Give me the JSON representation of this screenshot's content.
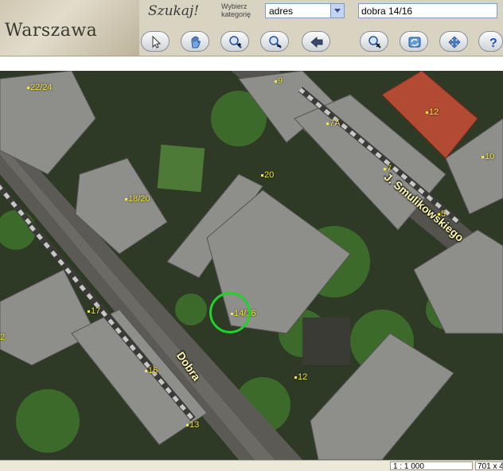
{
  "header": {
    "city": "Warszawa",
    "search_title": "Szukaj!",
    "category_label": "Wybierz kategorię",
    "category_value": "adres",
    "search_value": "dobra 14/16"
  },
  "toolbar": [
    {
      "name": "pointer-icon"
    },
    {
      "name": "pan-hand-icon"
    },
    {
      "name": "zoom-in-icon"
    },
    {
      "name": "zoom-out-icon"
    },
    {
      "name": "back-arrow-icon"
    },
    {
      "name": "zoom-clear-icon"
    },
    {
      "name": "refresh-icon"
    },
    {
      "name": "full-extent-icon"
    },
    {
      "name": "help-icon"
    }
  ],
  "map": {
    "streets": [
      "J. Smulikowskiego",
      "Dobra"
    ],
    "labels": [
      "22/24",
      "9",
      "12",
      "7A",
      "10",
      "20",
      "7",
      "18/20",
      "5",
      "14/16",
      "17",
      "2",
      "15",
      "12",
      "13"
    ],
    "marker_color": "#22d12a",
    "label_color": "#f4e83a"
  },
  "status": {
    "scale": "1 : 1 000",
    "size": "701 x 4"
  }
}
